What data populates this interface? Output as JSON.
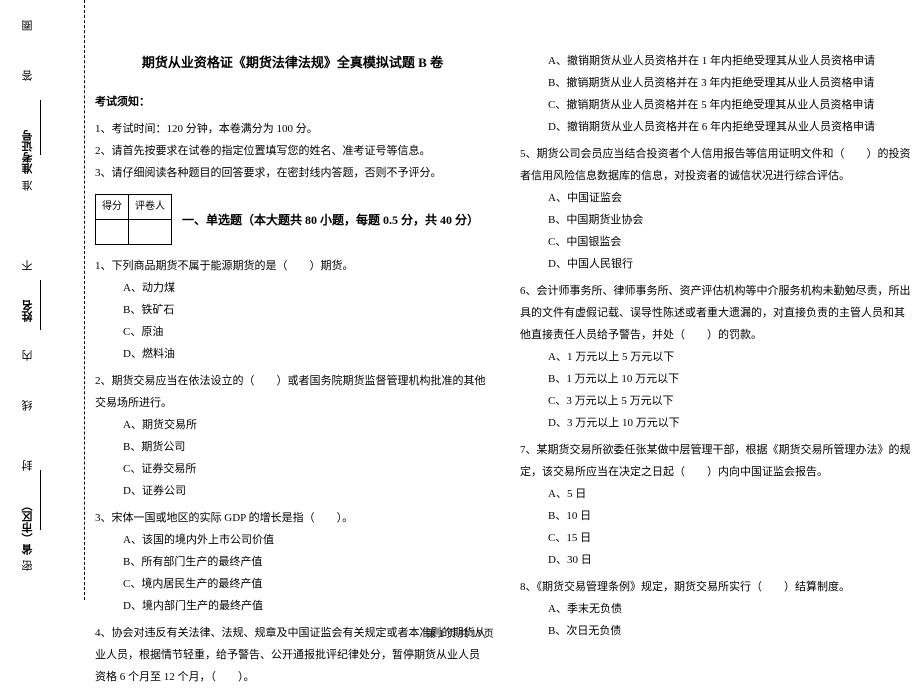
{
  "binding": {
    "quan": "圈",
    "da": "答",
    "zhunkao": "准考证号",
    "zhun": "准",
    "bu": "不",
    "xingming": "姓名",
    "nei": "内",
    "xian": "线",
    "feng": "封",
    "sheng": "省（市区）",
    "mi": "密"
  },
  "title": "期货从业资格证《期货法律法规》全真模拟试题 B 卷",
  "notice_head": "考试须知：",
  "notice": [
    "1、考试时间：120 分钟，本卷满分为 100 分。",
    "2、请首先按要求在试卷的指定位置填写您的姓名、准考证号等信息。",
    "3、请仔细阅读各种题目的回答要求，在密封线内答题，否则不予评分。"
  ],
  "score_cells": {
    "a": "得分",
    "b": "评卷人"
  },
  "section1_title": "一、单选题（本大题共 80 小题，每题 0.5 分，共 40 分）",
  "q1": "1、下列商品期货不属于能源期货的是（　　）期货。",
  "q1o": {
    "a": "A、动力煤",
    "b": "B、铁矿石",
    "c": "C、原油",
    "d": "D、燃料油"
  },
  "q2": "2、期货交易应当在依法设立的（　　）或者国务院期货监督管理机构批准的其他交易场所进行。",
  "q2o": {
    "a": "A、期货交易所",
    "b": "B、期货公司",
    "c": "C、证券交易所",
    "d": "D、证券公司"
  },
  "q3": "3、宋体一国或地区的实际 GDP 的增长是指（　　）。",
  "q3o": {
    "a": "A、该国的境内外上市公司价值",
    "b": "B、所有部门生产的最终产值",
    "c": "C、境内居民生产的最终产值",
    "d": "D、境内部门生产的最终产值"
  },
  "q4": "4、协会对违反有关法律、法规、规章及中国证监会有关规定或者本准则的期货从业人员，根据情节轻重，给予警告、公开通报批评纪律处分，暂停期货从业人员资格 6 个月至 12 个月，（　　）。",
  "q4o": {
    "a": "A、撤销期货从业人员资格并在 1 年内拒绝受理其从业人员资格申请",
    "b": "B、撤销期货从业人员资格并在 3 年内拒绝受理其从业人员资格申请",
    "c": "C、撤销期货从业人员资格并在 5 年内拒绝受理其从业人员资格申请",
    "d": "D、撤销期货从业人员资格并在 6 年内拒绝受理其从业人员资格申请"
  },
  "q5": "5、期货公司会员应当结合投资者个人信用报告等信用证明文件和（　　）的投资者信用风险信息数据库的信息，对投资者的诚信状况进行综合评估。",
  "q5o": {
    "a": "A、中国证监会",
    "b": "B、中国期货业协会",
    "c": "C、中国银监会",
    "d": "D、中国人民银行"
  },
  "q6": "6、会计师事务所、律师事务所、资产评估机构等中介服务机构未勤勉尽责，所出具的文件有虚假记载、误导性陈述或者重大遗漏的，对直接负责的主管人员和其他直接责任人员给予警告，并处（　　）的罚款。",
  "q6o": {
    "a": "A、1 万元以上 5 万元以下",
    "b": "B、1 万元以上 10 万元以下",
    "c": "C、3 万元以上 5 万元以下",
    "d": "D、3 万元以上 10 万元以下"
  },
  "q7": "7、某期货交易所欲委任张某做中层管理干部，根据《期货交易所管理办法》的规定，该交易所应当在决定之日起（　　）内向中国证监会报告。",
  "q7o": {
    "a": "A、5 日",
    "b": "B、10 日",
    "c": "C、15 日",
    "d": "D、30 日"
  },
  "q8": "8、《期货交易管理条例》规定，期货交易所实行（　　）结算制度。",
  "q8o": {
    "a": "A、季末无负债",
    "b": "B、次日无负债"
  },
  "footer": "第 1 页 共 17 页"
}
